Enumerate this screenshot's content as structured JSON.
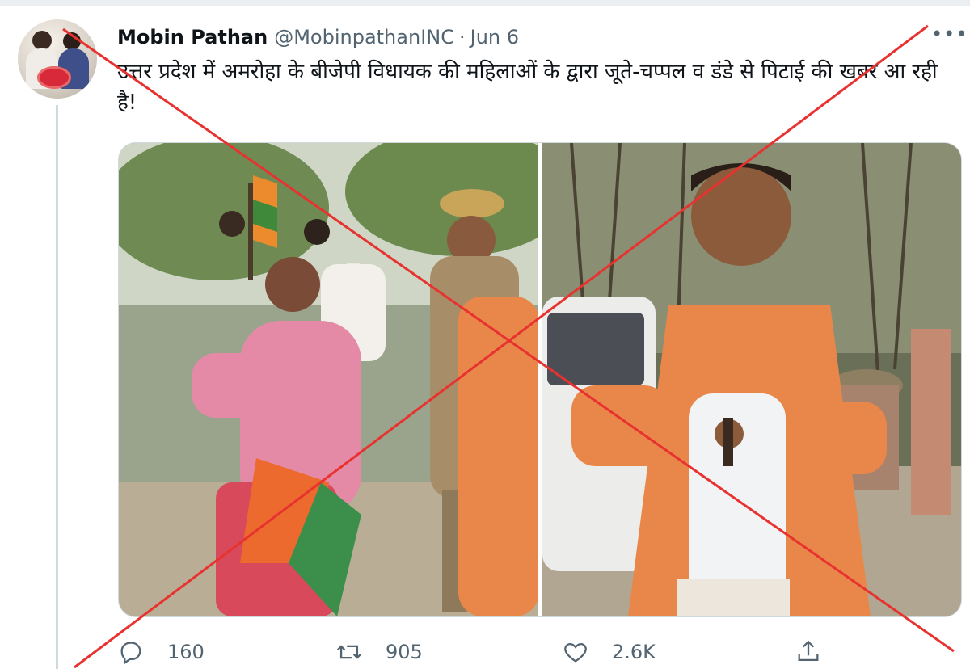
{
  "tweet": {
    "author_name": "Mobin Pathan",
    "author_handle": "@MobinpathanINC",
    "separator": "·",
    "date": "Jun 6",
    "more_label": "•••",
    "text": "उत्तर प्रदेश में अमरोहा के बीजेपी विधायक की महिलाओं के द्वारा जूते-चप्पल व डंडे से पिटाई की खबर आ रही है!"
  },
  "actions": {
    "reply_icon": "reply-icon",
    "reply_count": "160",
    "retweet_icon": "retweet-icon",
    "retweet_count": "905",
    "like_icon": "heart-icon",
    "like_count": "2.6K",
    "share_icon": "share-icon"
  },
  "overlay": {
    "mark": "red-x-cross",
    "color": "#e8322f"
  },
  "colors": {
    "text": "#0f1419",
    "secondary": "#536471",
    "border": "#cfd9de",
    "saffron": "#e9874a"
  }
}
